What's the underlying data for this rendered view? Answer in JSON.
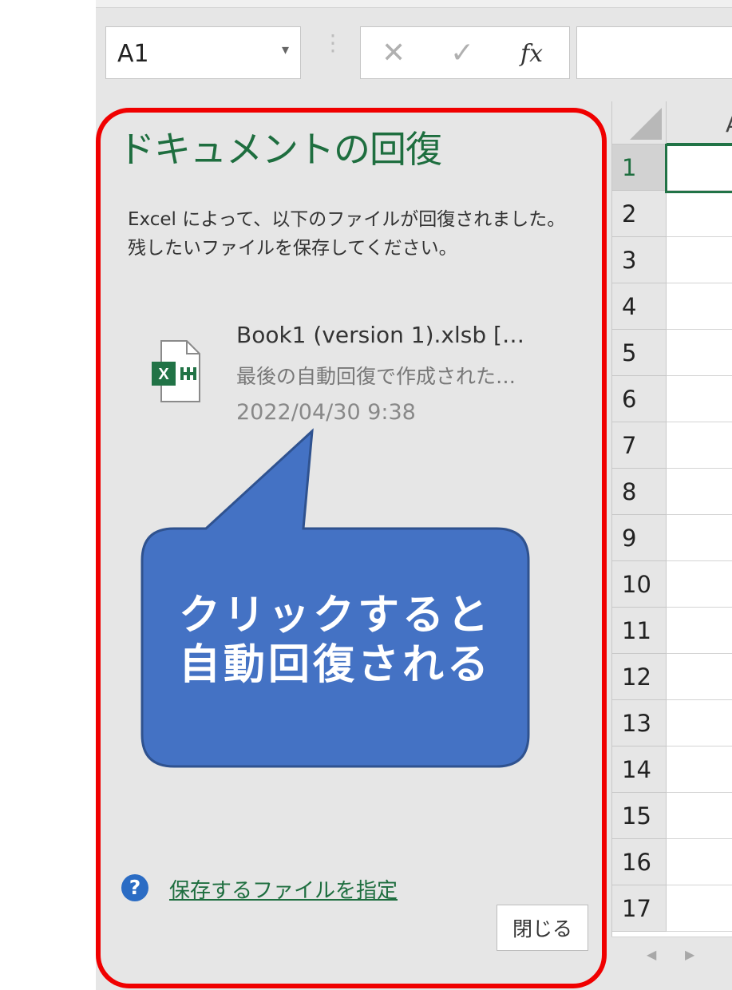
{
  "formula_bar": {
    "name_box": "A1",
    "cancel_glyph": "✕",
    "enter_glyph": "✓",
    "fx_label": "fx"
  },
  "grid": {
    "column_header": "A",
    "row_numbers": [
      "1",
      "2",
      "3",
      "4",
      "5",
      "6",
      "7",
      "8",
      "9",
      "10",
      "11",
      "12",
      "13",
      "14",
      "15",
      "16",
      "17"
    ]
  },
  "recovery_pane": {
    "title": "ドキュメントの回復",
    "description_line1": "Excel によって、以下のファイルが回復されました。",
    "description_line2": "残したいファイルを保存してください。",
    "file": {
      "name": "Book1 (version 1).xlsb  […",
      "status": "最後の自動回復で作成された…",
      "timestamp": "2022/04/30 9:38",
      "icon": "excel-binary-file-icon"
    },
    "help_link": "保存するファイルを指定",
    "close_label": "閉じる"
  },
  "annotation": {
    "callout_line1": "クリックすると",
    "callout_line2": "自動回復される",
    "frame_color": "#f00000",
    "callout_color": "#4472c4"
  },
  "colors": {
    "excel_green": "#217346",
    "title_green": "#1e6e3f",
    "pane_bg": "#e6e6e6"
  }
}
